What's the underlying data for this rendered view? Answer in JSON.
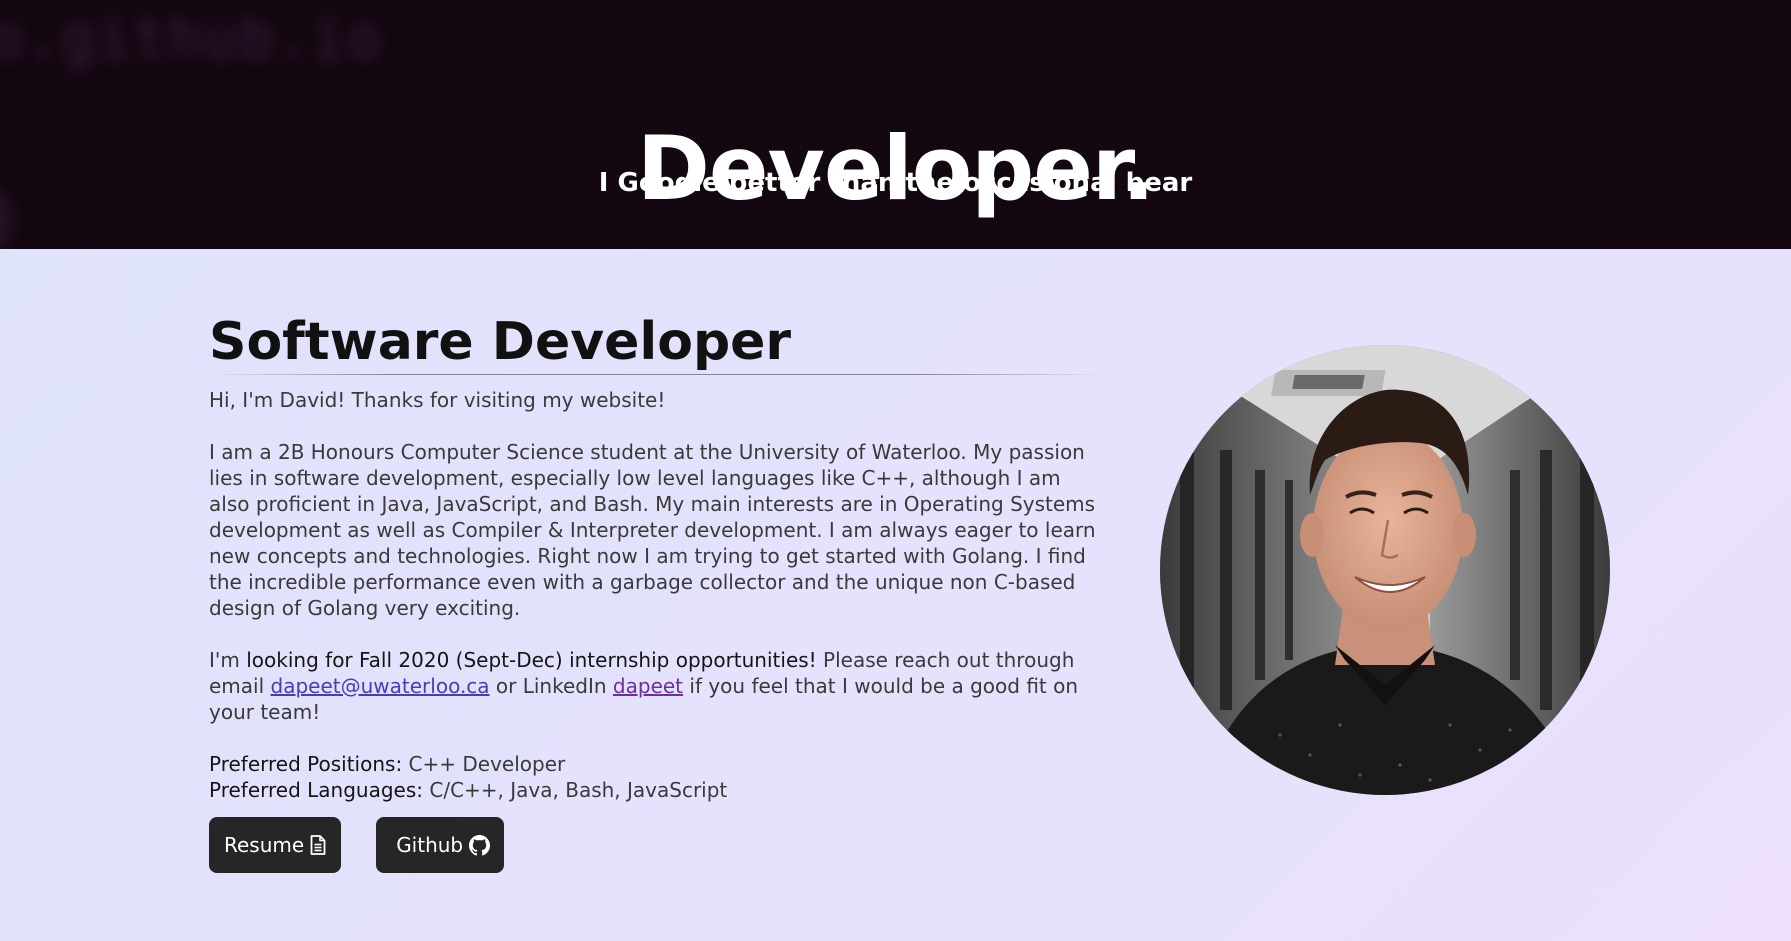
{
  "hero": {
    "title": "Developer.",
    "subtitle": "I Google better than the occasional bear"
  },
  "about": {
    "heading": "Software Developer",
    "greeting": "Hi, I'm David! Thanks for visiting my website!",
    "bio": "I am a 2B Honours Computer Science student at the University of Waterloo. My passion lies in software development, especially low level languages like C++, although I am also proficient in Java, JavaScript, and Bash. My main interests are in Operating Systems development as well as Compiler & Interpreter development. I am always eager to learn new concepts and technologies. Right now I am trying to get started with Golang. I find the incredible performance even with a garbage collector and the unique non C-based design of Golang very exciting.",
    "internship": {
      "prefix": "I'm ",
      "highlight": "looking for Fall 2020 (Sept-Dec) internship opportunities!",
      "middle": " Please reach out through email ",
      "email_link": "dapeet@uwaterloo.ca",
      "connector": " or LinkedIn ",
      "linkedin_link": "dapeet",
      "suffix": " if you feel that I would be a good fit on your team!"
    },
    "preferences": {
      "positions_label": "Preferred Positions:",
      "positions_value": " C++ Developer",
      "languages_label": "Preferred Languages:",
      "languages_value": " C/C++, Java, Bash, JavaScript"
    }
  },
  "buttons": {
    "resume_label": "Resume",
    "resume_icon": "file-icon",
    "github_label": "Github",
    "github_icon": "github-icon"
  },
  "colors": {
    "hero_bg": "#130711",
    "button_bg": "#262626",
    "link": "#4a3bb8"
  }
}
